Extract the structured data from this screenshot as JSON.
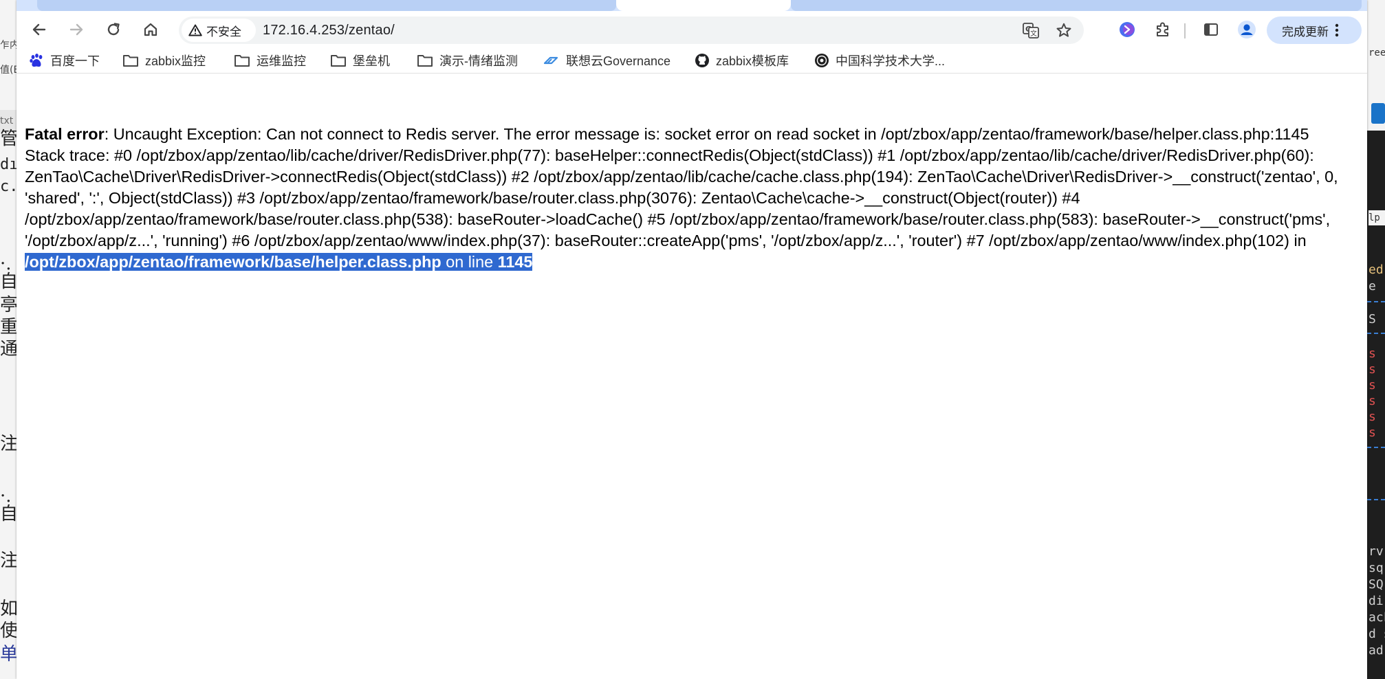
{
  "browser": {
    "security_label": "不安全",
    "url": "172.16.4.253/zentao/",
    "update_button_label": "完成更新"
  },
  "bookmarks": [
    {
      "label": "百度一下",
      "icon": "baidu-paw-icon"
    },
    {
      "label": "zabbix监控",
      "icon": "folder-icon"
    },
    {
      "label": "运维监控",
      "icon": "folder-icon"
    },
    {
      "label": "堡垒机",
      "icon": "folder-icon"
    },
    {
      "label": "演示-情绪监测",
      "icon": "folder-icon"
    },
    {
      "label": "联想云Governance",
      "icon": "lenovo-cloud-icon"
    },
    {
      "label": "zabbix模板库",
      "icon": "github-icon"
    },
    {
      "label": "中国科学技术大学...",
      "icon": "ustc-logo-icon"
    }
  ],
  "error": {
    "label": "Fatal error",
    "message": ": Uncaught Exception: Can not connect to Redis server. The error message is: socket error on read socket in /opt/zbox/app/zentao/framework/base/helper.class.php:1145 Stack trace: #0 /opt/zbox/app/zentao/lib/cache/driver/RedisDriver.php(77): baseHelper::connectRedis(Object(stdClass)) #1 /opt/zbox/app/zentao/lib/cache/driver/RedisDriver.php(60): ZenTao\\Cache\\Driver\\RedisDriver->connectRedis(Object(stdClass)) #2 /opt/zbox/app/zentao/lib/cache/cache.class.php(194): ZenTao\\Cache\\Driver\\RedisDriver->__construct('zentao', 0, 'shared', ':', Object(stdClass)) #3 /opt/zbox/app/zentao/framework/base/router.class.php(3076): Zentao\\Cache\\cache->__construct(Object(router)) #4 /opt/zbox/app/zentao/framework/base/router.class.php(538): baseRouter->loadCache() #5 /opt/zbox/app/zentao/framework/base/router.class.php(583): baseRouter->__construct('pms', '/opt/zbox/app/z...', 'running') #6 /opt/zbox/app/zentao/www/index.php(37): baseRouter::createApp('pms', '/opt/zbox/app/z...', 'router') #7 /opt/zbox/app/zentao/www/index.php(102) in ",
    "file": "/opt/zbox/app/zentao/framework/base/helper.class.php",
    "line_word": " on line ",
    "line_number": "1145"
  },
  "background_left": {
    "glyphs": [
      "管",
      "dı",
      "c.",
      "·.",
      "自",
      "亭",
      "重",
      "通",
      "注",
      "·.",
      "自",
      "注",
      "如",
      "使",
      "单"
    ],
    "partial_labels": [
      "乍内",
      "值(E)",
      "txt"
    ]
  },
  "background_right": {
    "lines": [
      "ed",
      "e",
      "S",
      "s",
      "s",
      "s",
      "s",
      "s",
      "s",
      "rv",
      "sq",
      "SQ",
      "di",
      "ack",
      "d s",
      "ad"
    ],
    "partial_labels": [
      "ree",
      "lp"
    ]
  }
}
